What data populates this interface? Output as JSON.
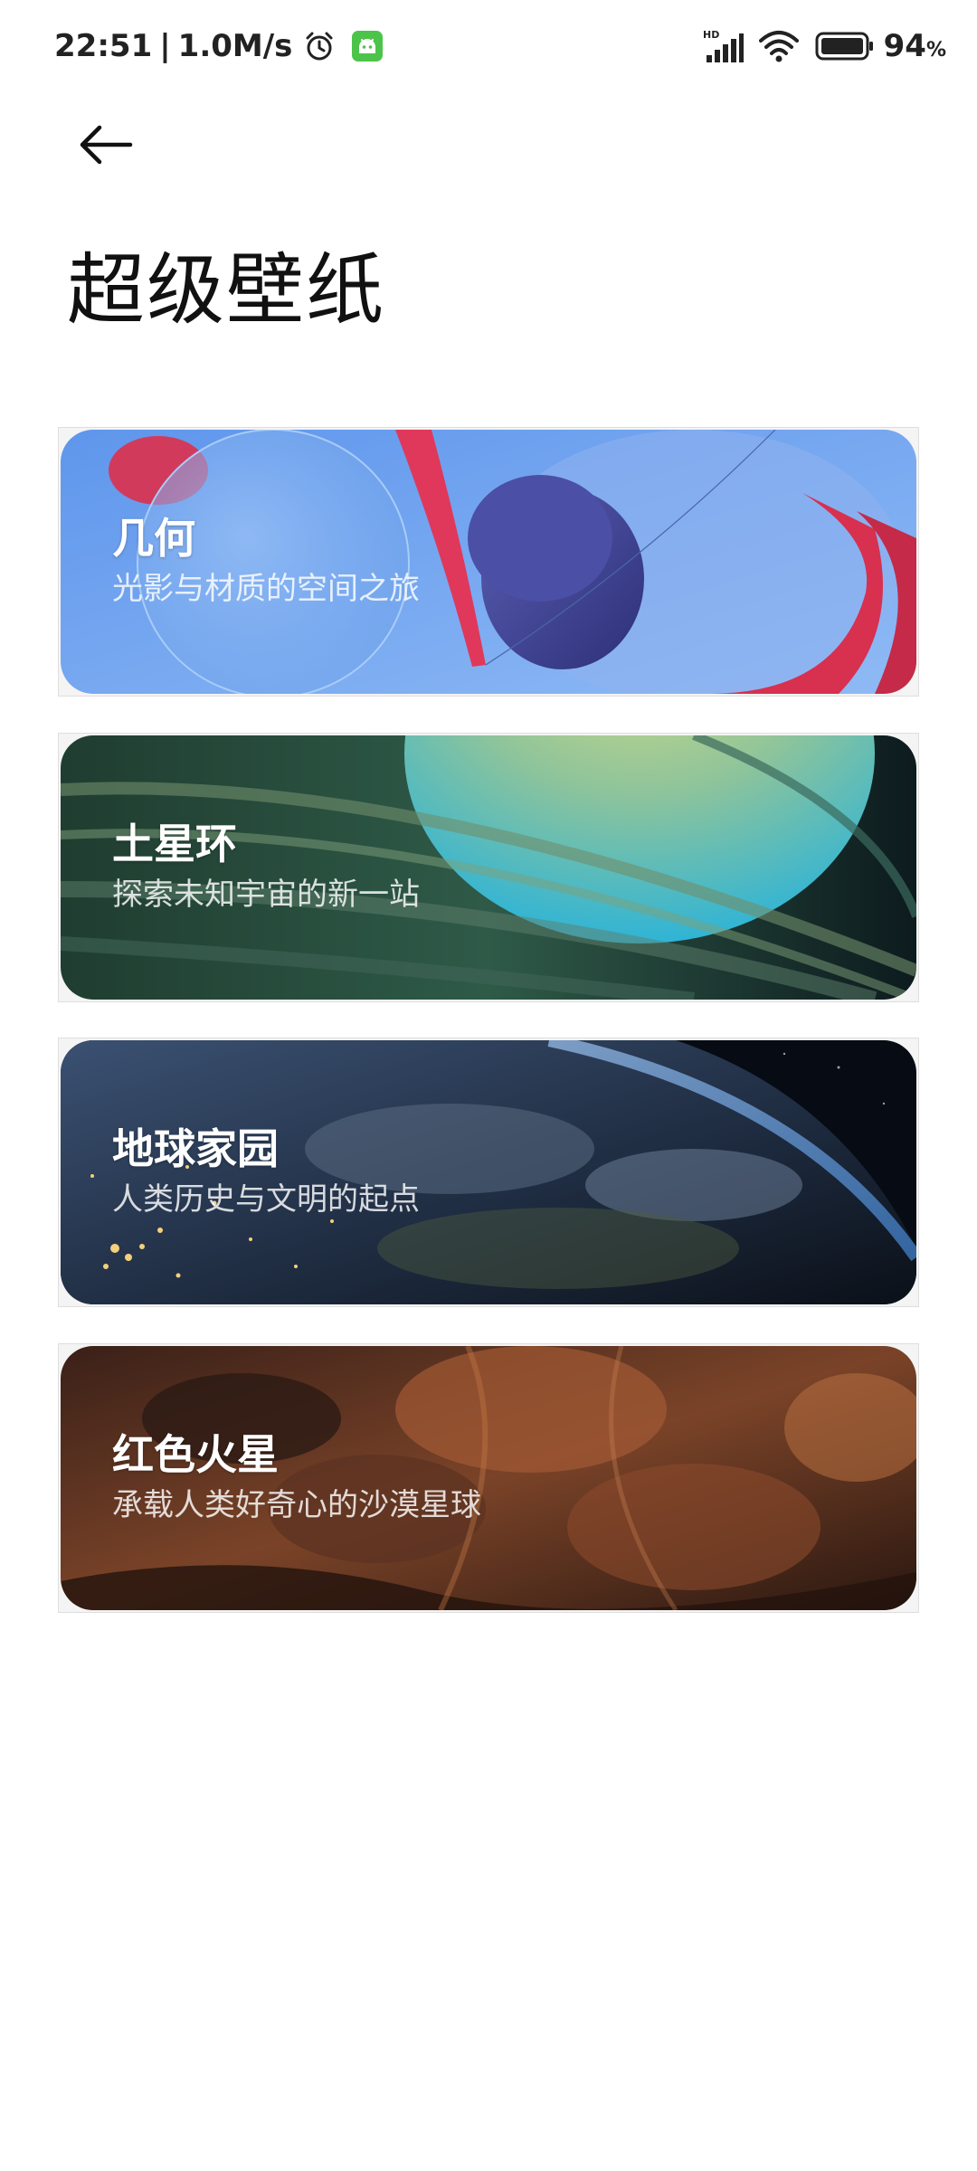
{
  "status_bar": {
    "time": "22:51",
    "separator": "|",
    "speed": "1.0M/s",
    "network_label": "HD",
    "battery_value": "94",
    "battery_unit": "%"
  },
  "icons": {
    "back": "back-arrow-icon",
    "alarm": "alarm-clock-icon",
    "app_badge": "android-app-icon",
    "signal": "cellular-signal-icon",
    "wifi": "wifi-icon",
    "battery": "battery-icon"
  },
  "header": {
    "title": "超级壁纸"
  },
  "cards": [
    {
      "title": "几何",
      "subtitle": "光影与材质的空间之旅",
      "color": "#6ea4ee"
    },
    {
      "title": "土星环",
      "subtitle": "探索未知宇宙的新一站",
      "color": "#2f5a4a"
    },
    {
      "title": "地球家园",
      "subtitle": "人类历史与文明的起点",
      "color": "#22344f"
    },
    {
      "title": "红色火星",
      "subtitle": "承载人类好奇心的沙漠星球",
      "color": "#6b3a24"
    }
  ]
}
